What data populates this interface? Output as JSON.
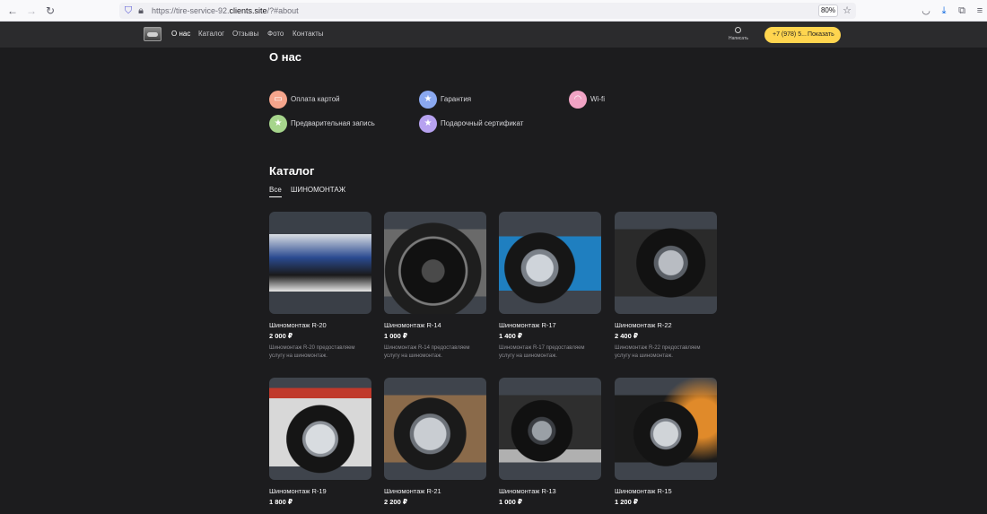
{
  "browser": {
    "url_prefix": "https://tire-service-92.",
    "url_domain": "clients.site",
    "url_suffix": "/?#about",
    "zoom": "80%"
  },
  "header": {
    "nav": [
      "О нас",
      "Каталог",
      "Отзывы",
      "Фото",
      "Контакты"
    ],
    "write_label": "Написать",
    "phone": "+7 (978) 5...",
    "show_label": "Показать"
  },
  "about": {
    "title": "О нас",
    "features": [
      {
        "label": "Оплата картой",
        "icon": "card-icon",
        "color": "#f5a58c",
        "glyph": "▭"
      },
      {
        "label": "Гарантия",
        "icon": "star-icon",
        "color": "#8aa8f0",
        "glyph": "★"
      },
      {
        "label": "Wi-fi",
        "icon": "wifi-icon",
        "color": "#f0a3c4",
        "glyph": "◠"
      },
      {
        "label": "Предварительная запись",
        "icon": "star-icon",
        "color": "#a6d58c",
        "glyph": "★"
      },
      {
        "label": "Подарочный сертификат",
        "icon": "star-icon",
        "color": "#b7a2f0",
        "glyph": "★"
      }
    ]
  },
  "catalog": {
    "title": "Каталог",
    "tabs": [
      "Все",
      "ШИНОМОНТАЖ"
    ],
    "items": [
      {
        "title": "Шиномонтаж R-20",
        "price": "2 000 ₽",
        "desc": "Шиномонтаж R-20 предоставляем услугу на шиномонтаж."
      },
      {
        "title": "Шиномонтаж R-14",
        "price": "1 000 ₽",
        "desc": "Шиномонтаж R-14 предоставляем услугу на шиномонтаж."
      },
      {
        "title": "Шиномонтаж R-17",
        "price": "1 400 ₽",
        "desc": "Шиномонтаж R-17 предоставляем услугу на шиномонтаж."
      },
      {
        "title": "Шиномонтаж R-22",
        "price": "2 400 ₽",
        "desc": "Шиномонтаж R-22 предоставляем услугу на шиномонтаж."
      },
      {
        "title": "Шиномонтаж R-19",
        "price": "1 800 ₽",
        "desc": ""
      },
      {
        "title": "Шиномонтаж R-21",
        "price": "2 200 ₽",
        "desc": ""
      },
      {
        "title": "Шиномонтаж R-13",
        "price": "1 000 ₽",
        "desc": ""
      },
      {
        "title": "Шиномонтаж R-15",
        "price": "1 200 ₽",
        "desc": ""
      }
    ]
  }
}
